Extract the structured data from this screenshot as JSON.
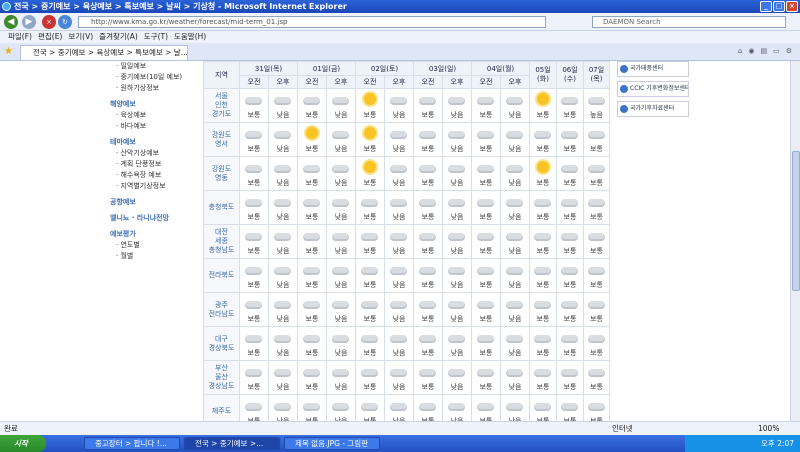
{
  "window": {
    "title": "전국 > 중기예보 > 육상예보 > 특보예보 > 날씨 > 기상청 - Microsoft Internet Explorer"
  },
  "address": {
    "url": "http://www.kma.go.kr/weather/forecast/mid-term_01.jsp",
    "search_placeholder": "DAEMON Search"
  },
  "menu": [
    "파일(F)",
    "편집(E)",
    "보기(V)",
    "즐겨찾기(A)",
    "도구(T)",
    "도움말(H)"
  ],
  "tab": {
    "label": "전국 > 중기예보 > 육상예보 > 특보예보 > 날..."
  },
  "sidebar": [
    {
      "kind": "it",
      "label": "· 일일예보"
    },
    {
      "kind": "it",
      "label": "· 중기예보(10일 예보)"
    },
    {
      "kind": "it",
      "label": "· 원하기상정보"
    },
    {
      "kind": "hd",
      "label": "해양예보"
    },
    {
      "kind": "it",
      "label": "· 육상예보"
    },
    {
      "kind": "it",
      "label": "· 바다예보"
    },
    {
      "kind": "hd",
      "label": "테마예보"
    },
    {
      "kind": "it",
      "label": "· 산악기상예보"
    },
    {
      "kind": "it",
      "label": "· 계획 단풍정보"
    },
    {
      "kind": "it",
      "label": "· 해수욕장 예보"
    },
    {
      "kind": "it",
      "label": "· 지역별기상정보"
    },
    {
      "kind": "hd",
      "label": "공항예보"
    },
    {
      "kind": "hd",
      "label": "엘니뇨 · 라니냐전망"
    },
    {
      "kind": "hd",
      "label": "예보평가"
    },
    {
      "kind": "it",
      "label": "· 연도별"
    },
    {
      "kind": "it",
      "label": "· 월별"
    }
  ],
  "forecast": {
    "region_header": "지역",
    "dates": [
      {
        "label": "31일(목)",
        "split": true
      },
      {
        "label": "01일(금)",
        "split": true
      },
      {
        "label": "02일(토)",
        "split": true
      },
      {
        "label": "03일(일)",
        "split": true
      },
      {
        "label": "04일(월)",
        "split": true
      },
      {
        "label": "05일(화)",
        "split": false
      },
      {
        "label": "06일(수)",
        "split": false
      },
      {
        "label": "07일(목)",
        "split": false
      }
    ],
    "am": "오전",
    "pm": "오후",
    "rows": [
      {
        "region": "서울\n인천\n경기도",
        "cells": [
          [
            "c",
            "보통"
          ],
          [
            "c",
            "낮음"
          ],
          [
            "c",
            "보통"
          ],
          [
            "c",
            "낮음"
          ],
          [
            "s",
            "보통"
          ],
          [
            "c",
            "낮음"
          ],
          [
            "c",
            "보통"
          ],
          [
            "c",
            "낮음"
          ],
          [
            "c",
            "보통"
          ],
          [
            "c",
            "낮음"
          ],
          [
            "s",
            "보통"
          ],
          [
            "c",
            "보통"
          ],
          [
            "c",
            "높음"
          ]
        ]
      },
      {
        "region": "강원도\n영서",
        "cells": [
          [
            "c",
            "보통"
          ],
          [
            "c",
            "낮음"
          ],
          [
            "s",
            "보통"
          ],
          [
            "c",
            "낮음"
          ],
          [
            "s",
            "보통"
          ],
          [
            "c",
            "낮음"
          ],
          [
            "c",
            "보통"
          ],
          [
            "c",
            "낮음"
          ],
          [
            "c",
            "보통"
          ],
          [
            "c",
            "낮음"
          ],
          [
            "c",
            "보통"
          ],
          [
            "c",
            "보통"
          ],
          [
            "c",
            "보통"
          ]
        ]
      },
      {
        "region": "강원도\n영동",
        "cells": [
          [
            "c",
            "보통"
          ],
          [
            "c",
            "낮음"
          ],
          [
            "c",
            "보통"
          ],
          [
            "c",
            "낮음"
          ],
          [
            "s",
            "보통"
          ],
          [
            "c",
            "낮음"
          ],
          [
            "c",
            "보통"
          ],
          [
            "c",
            "낮음"
          ],
          [
            "c",
            "보통"
          ],
          [
            "c",
            "낮음"
          ],
          [
            "s",
            "보통"
          ],
          [
            "c",
            "보통"
          ],
          [
            "c",
            "보통"
          ]
        ]
      },
      {
        "region": "충청북도",
        "cells": [
          [
            "c",
            "보통"
          ],
          [
            "c",
            "낮음"
          ],
          [
            "c",
            "보통"
          ],
          [
            "c",
            "낮음"
          ],
          [
            "c",
            "보통"
          ],
          [
            "c",
            "낮음"
          ],
          [
            "c",
            "보통"
          ],
          [
            "c",
            "낮음"
          ],
          [
            "c",
            "보통"
          ],
          [
            "c",
            "낮음"
          ],
          [
            "c",
            "보통"
          ],
          [
            "c",
            "보통"
          ],
          [
            "c",
            "보통"
          ]
        ]
      },
      {
        "region": "대전\n세종\n충청남도",
        "cells": [
          [
            "c",
            "보통"
          ],
          [
            "c",
            "낮음"
          ],
          [
            "c",
            "보통"
          ],
          [
            "c",
            "낮음"
          ],
          [
            "c",
            "보통"
          ],
          [
            "c",
            "낮음"
          ],
          [
            "c",
            "보통"
          ],
          [
            "c",
            "낮음"
          ],
          [
            "c",
            "보통"
          ],
          [
            "c",
            "낮음"
          ],
          [
            "c",
            "보통"
          ],
          [
            "c",
            "보통"
          ],
          [
            "c",
            "보통"
          ]
        ]
      },
      {
        "region": "전라북도",
        "cells": [
          [
            "c",
            "보통"
          ],
          [
            "c",
            "낮음"
          ],
          [
            "c",
            "보통"
          ],
          [
            "c",
            "낮음"
          ],
          [
            "c",
            "보통"
          ],
          [
            "c",
            "낮음"
          ],
          [
            "c",
            "보통"
          ],
          [
            "c",
            "낮음"
          ],
          [
            "c",
            "보통"
          ],
          [
            "c",
            "낮음"
          ],
          [
            "c",
            "보통"
          ],
          [
            "c",
            "보통"
          ],
          [
            "c",
            "보통"
          ]
        ]
      },
      {
        "region": "광주\n전라남도",
        "cells": [
          [
            "c",
            "보통"
          ],
          [
            "c",
            "낮음"
          ],
          [
            "c",
            "보통"
          ],
          [
            "c",
            "낮음"
          ],
          [
            "c",
            "보통"
          ],
          [
            "c",
            "낮음"
          ],
          [
            "c",
            "보통"
          ],
          [
            "c",
            "낮음"
          ],
          [
            "c",
            "보통"
          ],
          [
            "c",
            "낮음"
          ],
          [
            "c",
            "보통"
          ],
          [
            "c",
            "보통"
          ],
          [
            "c",
            "보통"
          ]
        ]
      },
      {
        "region": "대구\n경상북도",
        "cells": [
          [
            "c",
            "보통"
          ],
          [
            "c",
            "낮음"
          ],
          [
            "c",
            "보통"
          ],
          [
            "c",
            "낮음"
          ],
          [
            "c",
            "보통"
          ],
          [
            "c",
            "낮음"
          ],
          [
            "c",
            "보통"
          ],
          [
            "c",
            "낮음"
          ],
          [
            "c",
            "보통"
          ],
          [
            "c",
            "낮음"
          ],
          [
            "c",
            "보통"
          ],
          [
            "c",
            "보통"
          ],
          [
            "c",
            "보통"
          ]
        ]
      },
      {
        "region": "부산\n울산\n경상남도",
        "cells": [
          [
            "c",
            "보통"
          ],
          [
            "c",
            "낮음"
          ],
          [
            "c",
            "보통"
          ],
          [
            "c",
            "낮음"
          ],
          [
            "c",
            "보통"
          ],
          [
            "c",
            "낮음"
          ],
          [
            "c",
            "보통"
          ],
          [
            "c",
            "낮음"
          ],
          [
            "c",
            "보통"
          ],
          [
            "c",
            "낮음"
          ],
          [
            "c",
            "보통"
          ],
          [
            "c",
            "보통"
          ],
          [
            "c",
            "보통"
          ]
        ]
      },
      {
        "region": "제주도",
        "cells": [
          [
            "c",
            "보통"
          ],
          [
            "c",
            "낮음"
          ],
          [
            "c",
            "보통"
          ],
          [
            "c",
            "낮음"
          ],
          [
            "c",
            "보통"
          ],
          [
            "c",
            "낮음"
          ],
          [
            "c",
            "보통"
          ],
          [
            "c",
            "낮음"
          ],
          [
            "c",
            "보통"
          ],
          [
            "c",
            "낮음"
          ],
          [
            "c",
            "보통"
          ],
          [
            "c",
            "보통"
          ],
          [
            "c",
            "보통"
          ]
        ]
      }
    ]
  },
  "right_badges": [
    "국가태풍센터",
    "CCIC 기후변화정보센터",
    "국가기후자료센터"
  ],
  "status": {
    "left": "완료",
    "zone": "인터넷",
    "zoom": "100%"
  },
  "taskbar": {
    "start": "시작",
    "tasks": [
      "중고장터 > 팝니다 !...",
      "전국 > 중기예보 >...",
      "제목 없음.JPG - 그림판"
    ],
    "clock": "오후 2:07"
  },
  "colors": {
    "titlebar": "#1a47b8",
    "region_text": "#3b69ae"
  }
}
